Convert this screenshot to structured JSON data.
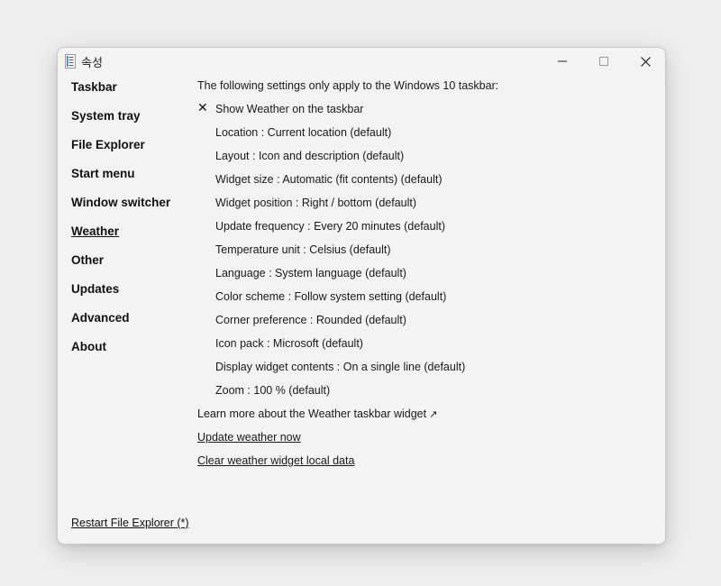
{
  "window": {
    "title": "속성",
    "controls": {
      "minimize": "—",
      "maximize": "☐",
      "close": "✕"
    }
  },
  "sidebar": {
    "items": [
      {
        "label": "Taskbar"
      },
      {
        "label": "System tray"
      },
      {
        "label": "File Explorer"
      },
      {
        "label": "Start menu"
      },
      {
        "label": "Window switcher"
      },
      {
        "label": "Weather",
        "active": true
      },
      {
        "label": "Other"
      },
      {
        "label": "Updates"
      },
      {
        "label": "Advanced"
      },
      {
        "label": "About"
      }
    ],
    "restart_label": "Restart File Explorer (*)"
  },
  "weather": {
    "heading": "The following settings only apply to the Windows 10 taskbar:",
    "show_weather": {
      "label": "Show Weather on the taskbar",
      "mark": "✕"
    },
    "settings": [
      "Location : Current location (default)",
      "Layout : Icon and description (default)",
      "Widget size : Automatic (fit contents) (default)",
      "Widget position : Right / bottom (default)",
      "Update frequency : Every 20 minutes (default)",
      "Temperature unit : Celsius (default)",
      "Language : System language (default)",
      "Color scheme : Follow system setting (default)",
      "Corner preference : Rounded (default)",
      "Icon pack : Microsoft (default)",
      "Display widget contents : On a single line (default)",
      "Zoom : 100 % (default)"
    ],
    "learn_more": {
      "label": "Learn more about the Weather taskbar widget",
      "arrow": "↗"
    },
    "update_now": "Update weather now",
    "clear_data": "Clear weather widget local data"
  },
  "icons": {
    "app": "app-icon",
    "check": "check-mark-icon",
    "external": "external-link-icon"
  },
  "colors": {
    "window_bg": "#f3f3f3",
    "page_bg": "#efefef",
    "text": "#111111",
    "app_icon_blue": "#2b6cd9"
  }
}
